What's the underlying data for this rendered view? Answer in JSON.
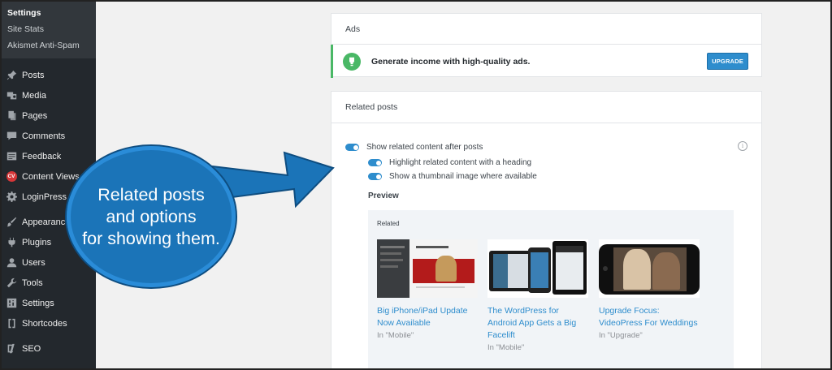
{
  "sidebar": {
    "submenu": [
      {
        "label": "Settings",
        "active": true
      },
      {
        "label": "Site Stats",
        "active": false
      },
      {
        "label": "Akismet Anti-Spam",
        "active": false
      }
    ],
    "items": [
      {
        "label": "Posts",
        "icon": "pin-icon"
      },
      {
        "label": "Media",
        "icon": "media-icon"
      },
      {
        "label": "Pages",
        "icon": "pages-icon"
      },
      {
        "label": "Comments",
        "icon": "comments-icon"
      },
      {
        "label": "Feedback",
        "icon": "feedback-icon"
      },
      {
        "label": "Content Views",
        "icon": "cv-icon",
        "badge": "CV"
      },
      {
        "label": "LoginPress",
        "icon": "gear-icon"
      },
      {
        "label": "Appearance",
        "icon": "brush-icon"
      },
      {
        "label": "Plugins",
        "icon": "plug-icon"
      },
      {
        "label": "Users",
        "icon": "users-icon"
      },
      {
        "label": "Tools",
        "icon": "wrench-icon"
      },
      {
        "label": "Settings",
        "icon": "settings-icon"
      },
      {
        "label": "Shortcodes",
        "icon": "brackets-icon"
      },
      {
        "label": "SEO",
        "icon": "seo-icon"
      }
    ]
  },
  "ads": {
    "title": "Ads",
    "message": "Generate income with high-quality ads.",
    "button": "UPGRADE"
  },
  "related_posts": {
    "title": "Related posts",
    "toggles": [
      {
        "label": "Show related content after posts",
        "on": true
      },
      {
        "label": "Highlight related content with a heading",
        "on": true
      },
      {
        "label": "Show a thumbnail image where available",
        "on": true
      }
    ],
    "preview_label": "Preview",
    "preview_heading": "Related",
    "posts": [
      {
        "title_line1": "Big iPhone/iPad Update",
        "title_line2": "Now Available",
        "category": "In \"Mobile\""
      },
      {
        "title_line1": "The WordPress for",
        "title_line2": "Android App Gets a Big",
        "title_line3": "Facelift",
        "category": "In \"Mobile\""
      },
      {
        "title_line1": "Upgrade Focus:",
        "title_line2": "VideoPress For Weddings",
        "category": "In \"Upgrade\""
      }
    ]
  },
  "callout": {
    "line1": "Related posts",
    "line2": "and options",
    "line3": "for showing them."
  },
  "colors": {
    "sidebar_bg": "#23282d",
    "accent_blue": "#2e8dcd",
    "success_green": "#4ab866",
    "callout_blue": "#1b74b8"
  }
}
